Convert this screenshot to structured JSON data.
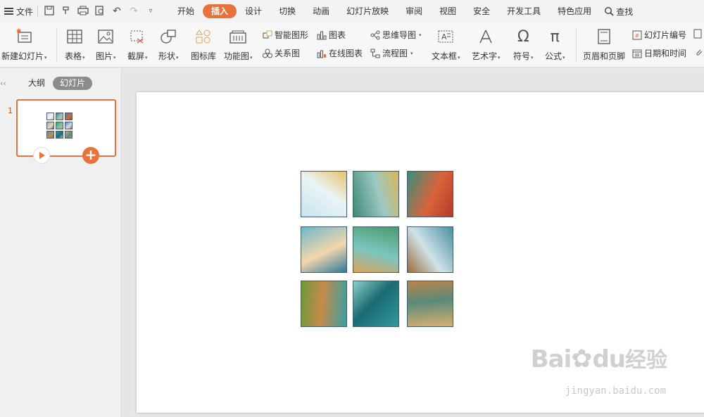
{
  "menu": {
    "file_label": "文件",
    "tabs": [
      "开始",
      "插入",
      "设计",
      "切换",
      "动画",
      "幻灯片放映",
      "审阅",
      "视图",
      "安全",
      "开发工具",
      "特色应用"
    ],
    "active_tab": "插入",
    "search_label": "查找"
  },
  "ribbon": {
    "new_slide": "新建幻灯片",
    "table": "表格",
    "picture": "图片",
    "screenshot": "截屏",
    "shape": "形状",
    "icon_lib": "图标库",
    "function_chart": "功能图",
    "smart_shape": "智能图形",
    "chart": "图表",
    "relation": "关系图",
    "online_chart": "在线图表",
    "mindmap": "思维导图",
    "flowchart": "流程图",
    "textbox": "文本框",
    "wordart": "艺术字",
    "symbol": "符号",
    "formula": "公式",
    "header_footer": "页眉和页脚",
    "slide_number": "幻灯片编号",
    "date_time": "日期和时间"
  },
  "panel": {
    "outline_tab": "大纲",
    "slides_tab": "幻灯片",
    "slide_number": "1"
  },
  "slide": {
    "images": [
      {
        "name": "sky-tile",
        "colors": [
          "#c6e3ee",
          "#eaf4f6",
          "#e8c26a"
        ]
      },
      {
        "name": "houses-tile",
        "colors": [
          "#3e8a76",
          "#9cc8c2",
          "#d9b65a"
        ]
      },
      {
        "name": "wall-tile",
        "colors": [
          "#3a8d7c",
          "#d8643b",
          "#b33a2a"
        ]
      },
      {
        "name": "girl-tile",
        "colors": [
          "#6fb8c6",
          "#f3d6ad",
          "#2e7a9c"
        ]
      },
      {
        "name": "canal-tile",
        "colors": [
          "#4b9a6a",
          "#7cc6c0",
          "#d9a25a"
        ]
      },
      {
        "name": "boat-tile",
        "colors": [
          "#4c8fa2",
          "#cfe3e8",
          "#9c6b3a"
        ]
      },
      {
        "name": "basket-tile",
        "colors": [
          "#3aa0a0",
          "#c68a4a",
          "#6a9a3a"
        ]
      },
      {
        "name": "pole-tile",
        "colors": [
          "#2f9a9c",
          "#1c6b73",
          "#8ad0c8"
        ]
      },
      {
        "name": "dock-tile",
        "colors": [
          "#d9b070",
          "#5a8a7a",
          "#b8844a"
        ]
      }
    ]
  },
  "watermark": {
    "brand": "Bai",
    "brand2": "du",
    "jingyan": "经验",
    "url": "jingyan.baidu.com"
  },
  "colors": {
    "accent": "#e8733a",
    "tile_border": "#3e5a78"
  }
}
